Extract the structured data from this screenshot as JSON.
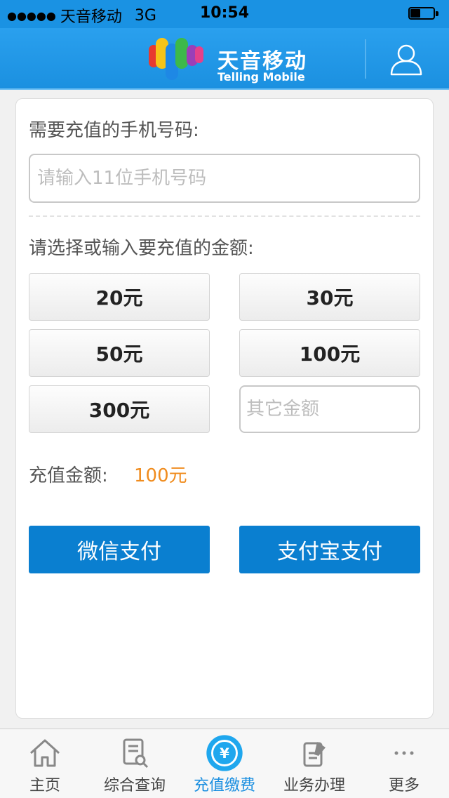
{
  "status_bar": {
    "signal": "●●●●●",
    "carrier": "天音移动",
    "network": "3G",
    "time": "10:54"
  },
  "header": {
    "logo_cn": "天音移动",
    "logo_en": "Telling Mobile"
  },
  "form": {
    "phone_label": "需要充值的手机号码:",
    "phone_placeholder": "请输入11位手机号码",
    "amount_label": "请选择或输入要充值的金额:",
    "amounts": [
      "20元",
      "30元",
      "50元",
      "100元",
      "300元"
    ],
    "other_placeholder": "其它金额",
    "total_label": "充值金额:",
    "total_value": "100元",
    "wechat_pay": "微信支付",
    "alipay": "支付宝支付"
  },
  "tabs": [
    {
      "label": "主页",
      "icon": "home-icon"
    },
    {
      "label": "综合查询",
      "icon": "query-document-icon"
    },
    {
      "label": "充值缴费",
      "icon": "yuan-coin-icon"
    },
    {
      "label": "业务办理",
      "icon": "service-document-icon"
    },
    {
      "label": "更多",
      "icon": "more-icon"
    }
  ],
  "active_tab": "充值缴费",
  "colors": {
    "header_blue": "#1b90e0",
    "pay_button": "#0a7fd0",
    "total_orange": "#f08c1e",
    "active_tab": "#1b8fe0"
  }
}
